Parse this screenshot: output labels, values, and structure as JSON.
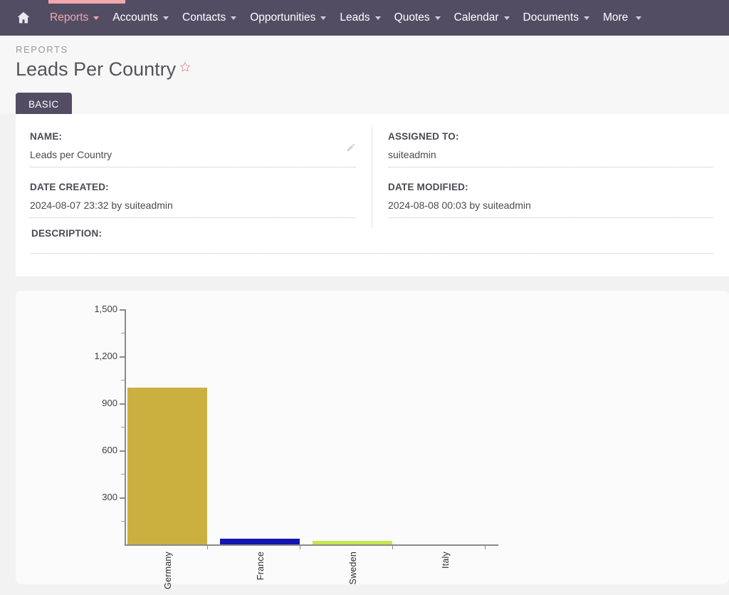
{
  "navbar": {
    "home_icon": "home-icon",
    "items": [
      {
        "label": "Reports",
        "active": true,
        "caret": true
      },
      {
        "label": "Accounts",
        "active": false,
        "caret": true
      },
      {
        "label": "Contacts",
        "active": false,
        "caret": true
      },
      {
        "label": "Opportunities",
        "active": false,
        "caret": true
      },
      {
        "label": "Leads",
        "active": false,
        "caret": true
      },
      {
        "label": "Quotes",
        "active": false,
        "caret": true
      },
      {
        "label": "Calendar",
        "active": false,
        "caret": true
      },
      {
        "label": "Documents",
        "active": false,
        "caret": true
      },
      {
        "label": "More",
        "active": false,
        "caret": true
      }
    ],
    "bg_color": "#534d64",
    "accent_color": "#f0a8ad"
  },
  "header": {
    "breadcrumb": "REPORTS",
    "title": "Leads Per Country",
    "favorite_icon": "star-outline-icon",
    "favorite_color": "#e8a0a4"
  },
  "tabs": [
    {
      "label": "BASIC",
      "active": true
    }
  ],
  "detail": {
    "name_label": "NAME:",
    "name_value": "Leads per Country",
    "assigned_to_label": "ASSIGNED TO:",
    "assigned_to_value": "suiteadmin",
    "date_created_label": "DATE CREATED:",
    "date_created_value": "2024-08-07 23:32 by suiteadmin",
    "date_modified_label": "DATE MODIFIED:",
    "date_modified_value": "2024-08-08 00:03 by suiteadmin",
    "description_label": "DESCRIPTION:",
    "description_value": "",
    "edit_icon": "pencil-icon"
  },
  "chart_data": {
    "type": "bar",
    "title": "",
    "xlabel": "",
    "ylabel": "",
    "categories": [
      "Germany",
      "France",
      "Sweden",
      "Italy"
    ],
    "values": [
      1000,
      35,
      25,
      0
    ],
    "colors": [
      "#ccb03f",
      "#1515b0",
      "#c4e84f",
      "#8a8a8a"
    ],
    "ylim": [
      0,
      1500
    ],
    "yticks_major": [
      300,
      600,
      900,
      1200,
      1500
    ],
    "ytick_labels": [
      "300",
      "600",
      "900",
      "1,200",
      "1,500"
    ],
    "yticks_minor": [
      150,
      450,
      750,
      1050,
      1350
    ],
    "grid": false,
    "legend": false
  }
}
